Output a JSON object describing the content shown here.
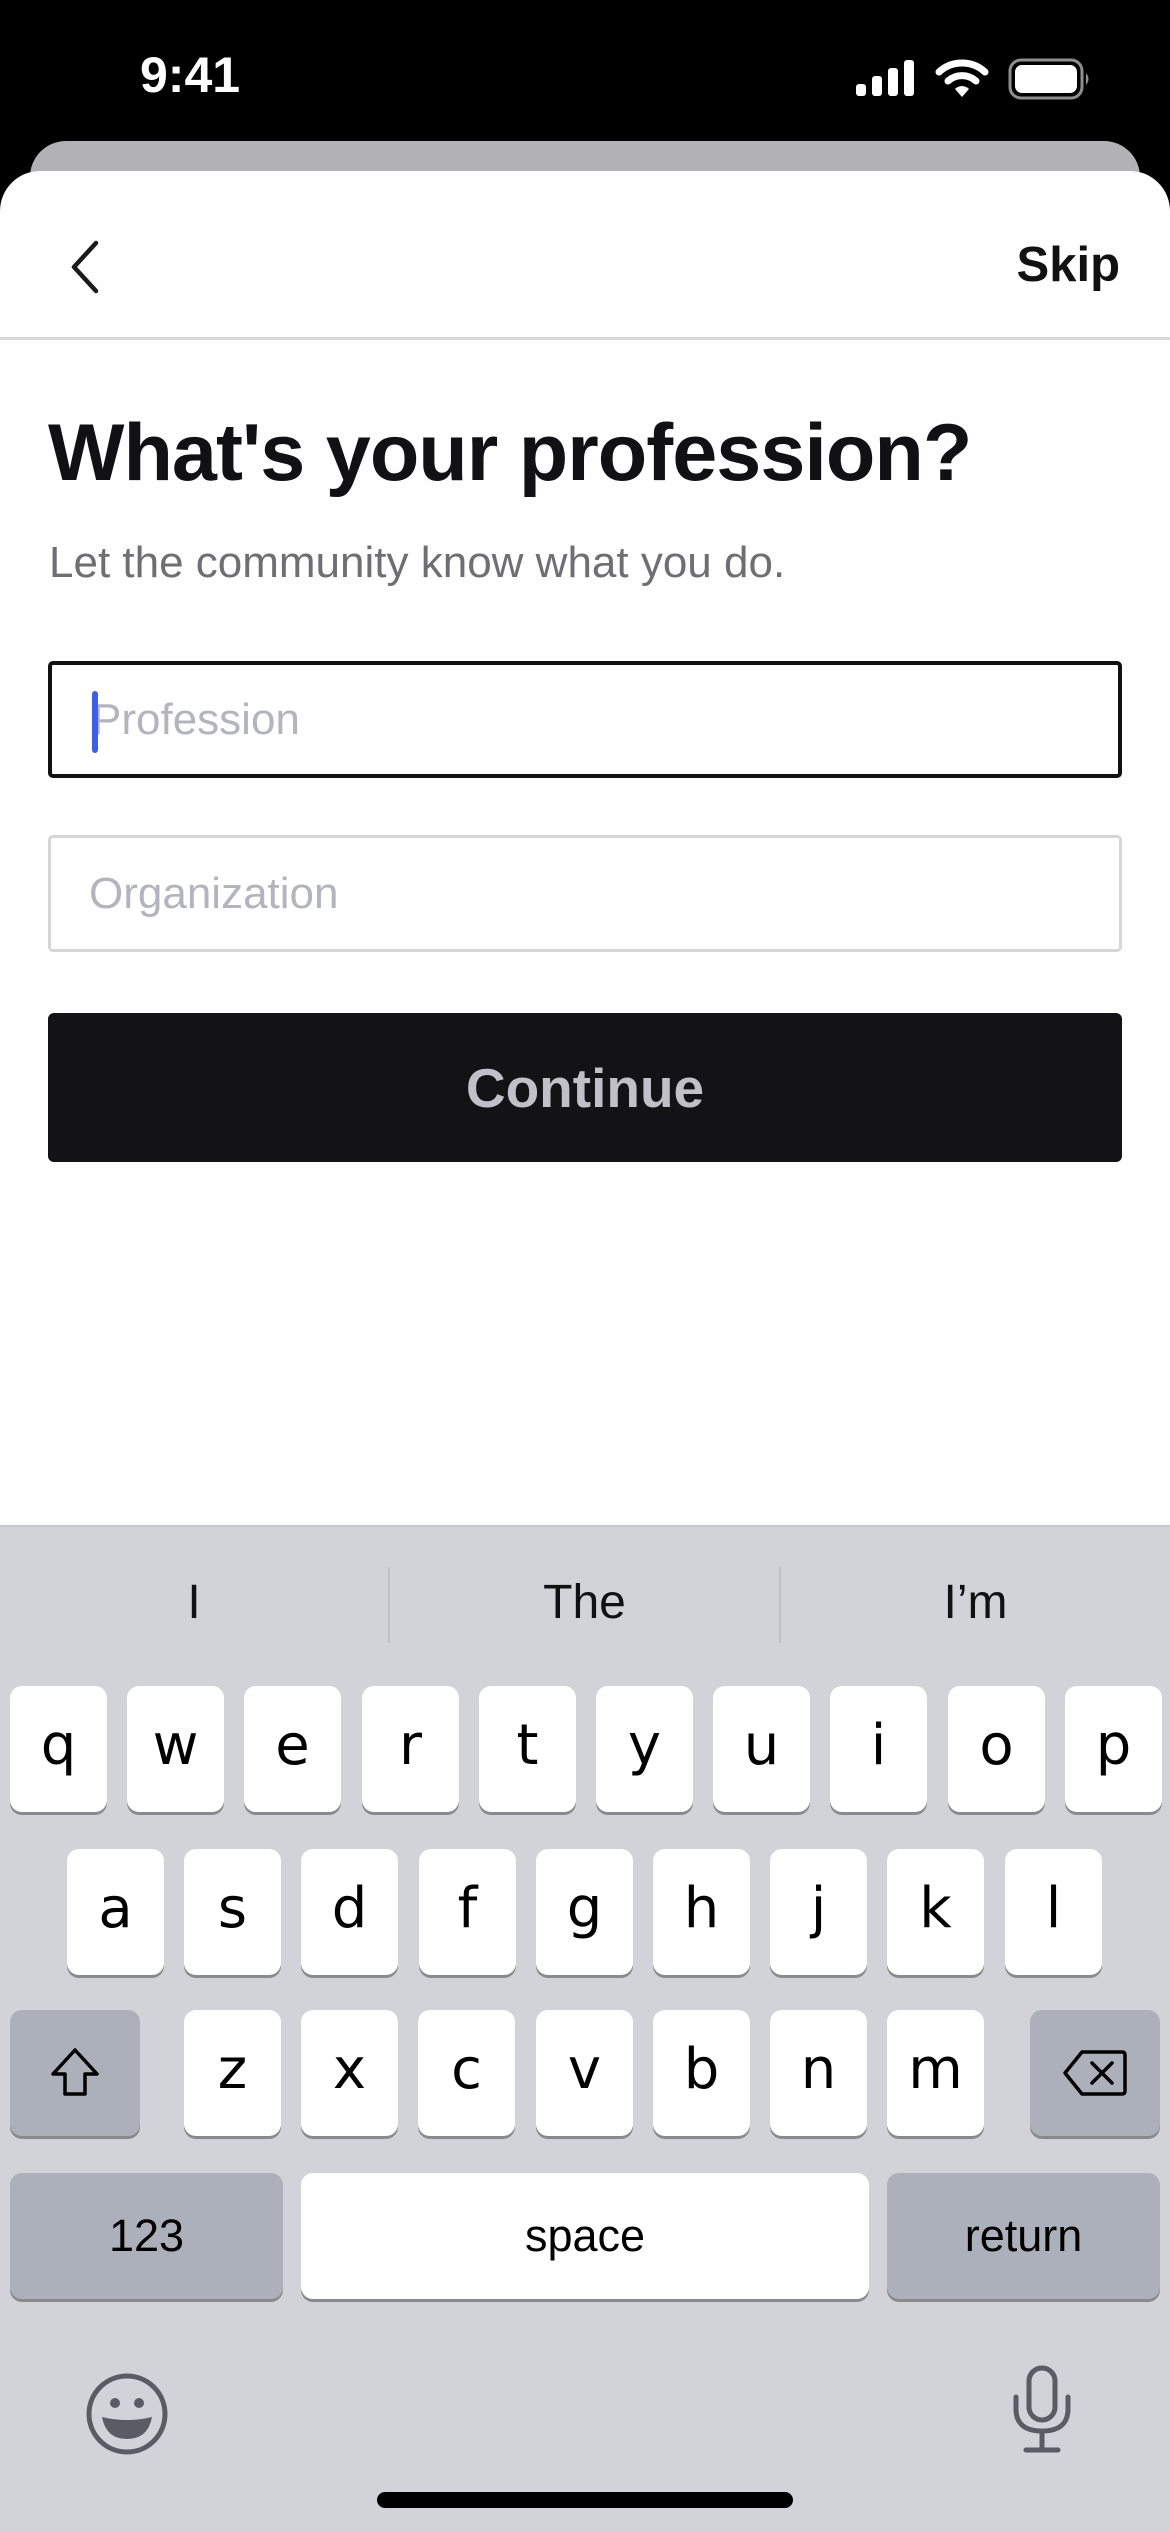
{
  "status_bar": {
    "time": "9:41",
    "icons": [
      "cellular-signal-icon",
      "wifi-icon",
      "battery-icon"
    ]
  },
  "nav": {
    "back_icon": "chevron-left-icon",
    "skip_label": "Skip"
  },
  "page": {
    "title": "What's your profession?",
    "subtitle": "Let the community know what you do."
  },
  "form": {
    "profession": {
      "value": "",
      "placeholder": "Profession",
      "focused": true
    },
    "organization": {
      "value": "",
      "placeholder": "Organization",
      "focused": false
    },
    "continue_label": "Continue"
  },
  "colors": {
    "caret": "#3f5de6",
    "button_bg": "#131215",
    "button_text": "#c1c0c8",
    "keyboard_bg": "#d2d3d8",
    "function_key_bg": "#acb0ba"
  },
  "keyboard": {
    "suggestions": [
      "I",
      "The",
      "I’m"
    ],
    "rows": [
      [
        "q",
        "w",
        "e",
        "r",
        "t",
        "y",
        "u",
        "i",
        "o",
        "p"
      ],
      [
        "a",
        "s",
        "d",
        "f",
        "g",
        "h",
        "j",
        "k",
        "l"
      ],
      [
        "z",
        "x",
        "c",
        "v",
        "b",
        "n",
        "m"
      ]
    ],
    "shift_icon": "shift-icon",
    "delete_icon": "delete-backspace-icon",
    "numbers_label": "123",
    "space_label": "space",
    "return_label": "return",
    "emoji_icon": "emoji-icon",
    "mic_icon": "microphone-icon"
  }
}
